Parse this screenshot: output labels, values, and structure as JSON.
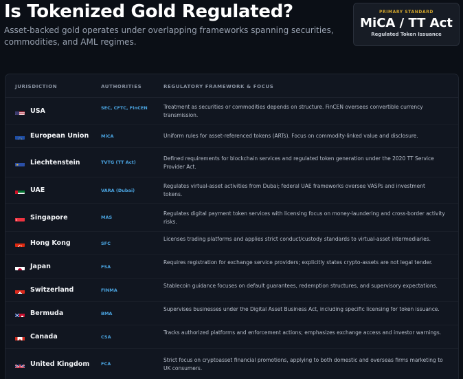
{
  "page": {
    "title": "Is Tokenized Gold Regulated?",
    "subtitle": "Asset-backed gold operates under overlapping frameworks spanning securities, commodities, and AML regimes."
  },
  "badge": {
    "label": "PRIMARY STANDARD",
    "value": "MiCA / TT Act",
    "caption": "Regulated Token Issuance"
  },
  "table": {
    "headers": [
      "JURISDICTION",
      "AUTHORITIES",
      "REGULATORY FRAMEWORK & FOCUS"
    ],
    "rows": [
      {
        "flag": "us-flag-icon",
        "jurisdiction": "USA",
        "authorities": "SEC, CFTC, FinCEN",
        "framework": "Treatment as securities or commodities depends on structure. FinCEN oversees convertible currency transmission."
      },
      {
        "flag": "eu-flag-icon",
        "jurisdiction": "European Union",
        "authorities": "MiCA",
        "framework": "Uniform rules for asset-referenced tokens (ARTs). Focus on commodity-linked value and disclosure."
      },
      {
        "flag": "liechtenstein-flag-icon",
        "jurisdiction": "Liechtenstein",
        "authorities": "TVTG (TT Act)",
        "framework": "Defined requirements for blockchain services and regulated token generation under the 2020 TT Service Provider Act."
      },
      {
        "flag": "uae-flag-icon",
        "jurisdiction": "UAE",
        "authorities": "VARA (Dubai)",
        "framework": "Regulates virtual-asset activities from Dubai; federal UAE frameworks oversee VASPs and investment tokens."
      },
      {
        "flag": "singapore-flag-icon",
        "jurisdiction": "Singapore",
        "authorities": "MAS",
        "framework": "Regulates digital payment token services with licensing focus on money-laundering and cross-border activity risks."
      },
      {
        "flag": "hong-kong-flag-icon",
        "jurisdiction": "Hong Kong",
        "authorities": "SFC",
        "framework": "Licenses trading platforms and applies strict conduct/custody standards to virtual-asset intermediaries."
      },
      {
        "flag": "japan-flag-icon",
        "jurisdiction": "Japan",
        "authorities": "FSA",
        "framework": "Requires registration for exchange service providers; explicitly states crypto-assets are not legal tender."
      },
      {
        "flag": "switzerland-flag-icon",
        "jurisdiction": "Switzerland",
        "authorities": "FINMA",
        "framework": "Stablecoin guidance focuses on default guarantees, redemption structures, and supervisory expectations."
      },
      {
        "flag": "bermuda-flag-icon",
        "jurisdiction": "Bermuda",
        "authorities": "BMA",
        "framework": "Supervises businesses under the Digital Asset Business Act, including specific licensing for token issuance."
      },
      {
        "flag": "canada-flag-icon",
        "jurisdiction": "Canada",
        "authorities": "CSA",
        "framework": "Tracks authorized platforms and enforcement actions; emphasizes exchange access and investor warnings."
      },
      {
        "flag": "uk-flag-icon",
        "jurisdiction": "United Kingdom",
        "authorities": "FCA",
        "framework": "Strict focus on cryptoasset financial promotions, applying to both domestic and overseas firms marketing to UK consumers."
      }
    ]
  }
}
